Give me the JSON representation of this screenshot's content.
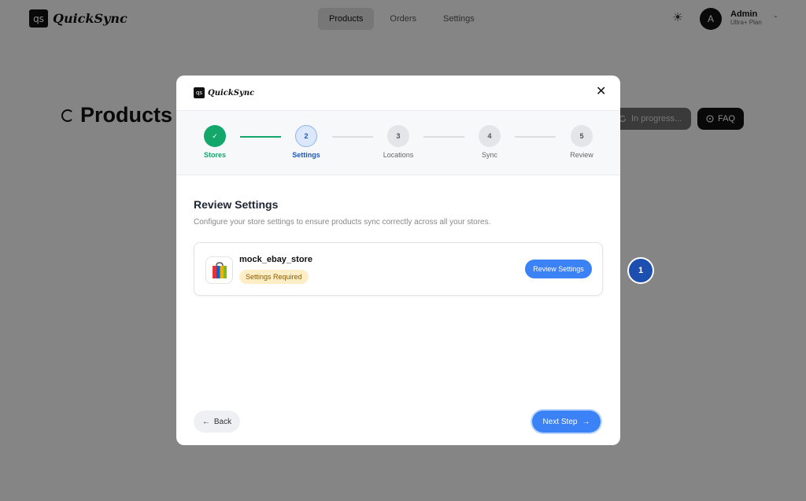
{
  "app": {
    "logo_mark": "qs",
    "logo_text": "QuickSync"
  },
  "nav": {
    "items": [
      "Products",
      "Orders",
      "Settings"
    ],
    "active": "Products"
  },
  "user": {
    "initial": "A",
    "name": "Admin",
    "plan": "Ultra+ Plan"
  },
  "page": {
    "title": "Products",
    "status_button": "In progress...",
    "faq_button": "FAQ"
  },
  "modal": {
    "logo_mark": "qs",
    "logo_text": "QuickSync",
    "close_label": "✕",
    "steps": [
      {
        "number": "✓",
        "label": "Stores",
        "state": "done"
      },
      {
        "number": "2",
        "label": "Settings",
        "state": "current"
      },
      {
        "number": "3",
        "label": "Locations",
        "state": "pending"
      },
      {
        "number": "4",
        "label": "Sync",
        "state": "pending"
      },
      {
        "number": "5",
        "label": "Review",
        "state": "pending"
      }
    ],
    "section_title": "Review Settings",
    "section_desc": "Configure your store settings to ensure products sync correctly across all your stores.",
    "store": {
      "name": "mock_ebay_store",
      "badge": "Settings Required",
      "review_button": "Review Settings"
    },
    "back_label": "Back",
    "next_label": "Next Step"
  },
  "marker": {
    "label": "1"
  },
  "colors": {
    "accent": "#3b82f6",
    "success": "#14a76c",
    "marker": "#1d4fb0",
    "warning_bg": "#fdeec6"
  }
}
